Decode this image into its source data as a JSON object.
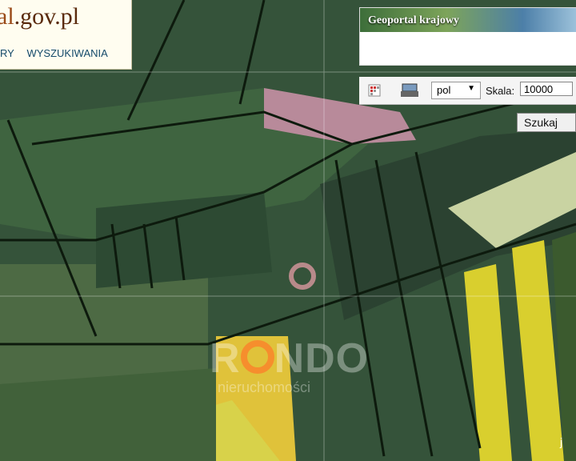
{
  "header": {
    "logo_prefix": "al",
    "logo_suffix": ".gov.pl",
    "nav": [
      "RY",
      "WYSZUKIWANIA"
    ]
  },
  "banner": {
    "title": "Geoportal krajowy"
  },
  "toolbar": {
    "language": "pol",
    "scale_label": "Skala:",
    "scale_value": "10000",
    "search_label": "Szukaj"
  },
  "watermark": {
    "brand_left": "R",
    "brand_right": "NDO",
    "sub": "nieruchomości"
  },
  "map": {
    "corner_text": "j",
    "field_color": "#3a5a32",
    "crop_color": "#d6cf3a"
  }
}
